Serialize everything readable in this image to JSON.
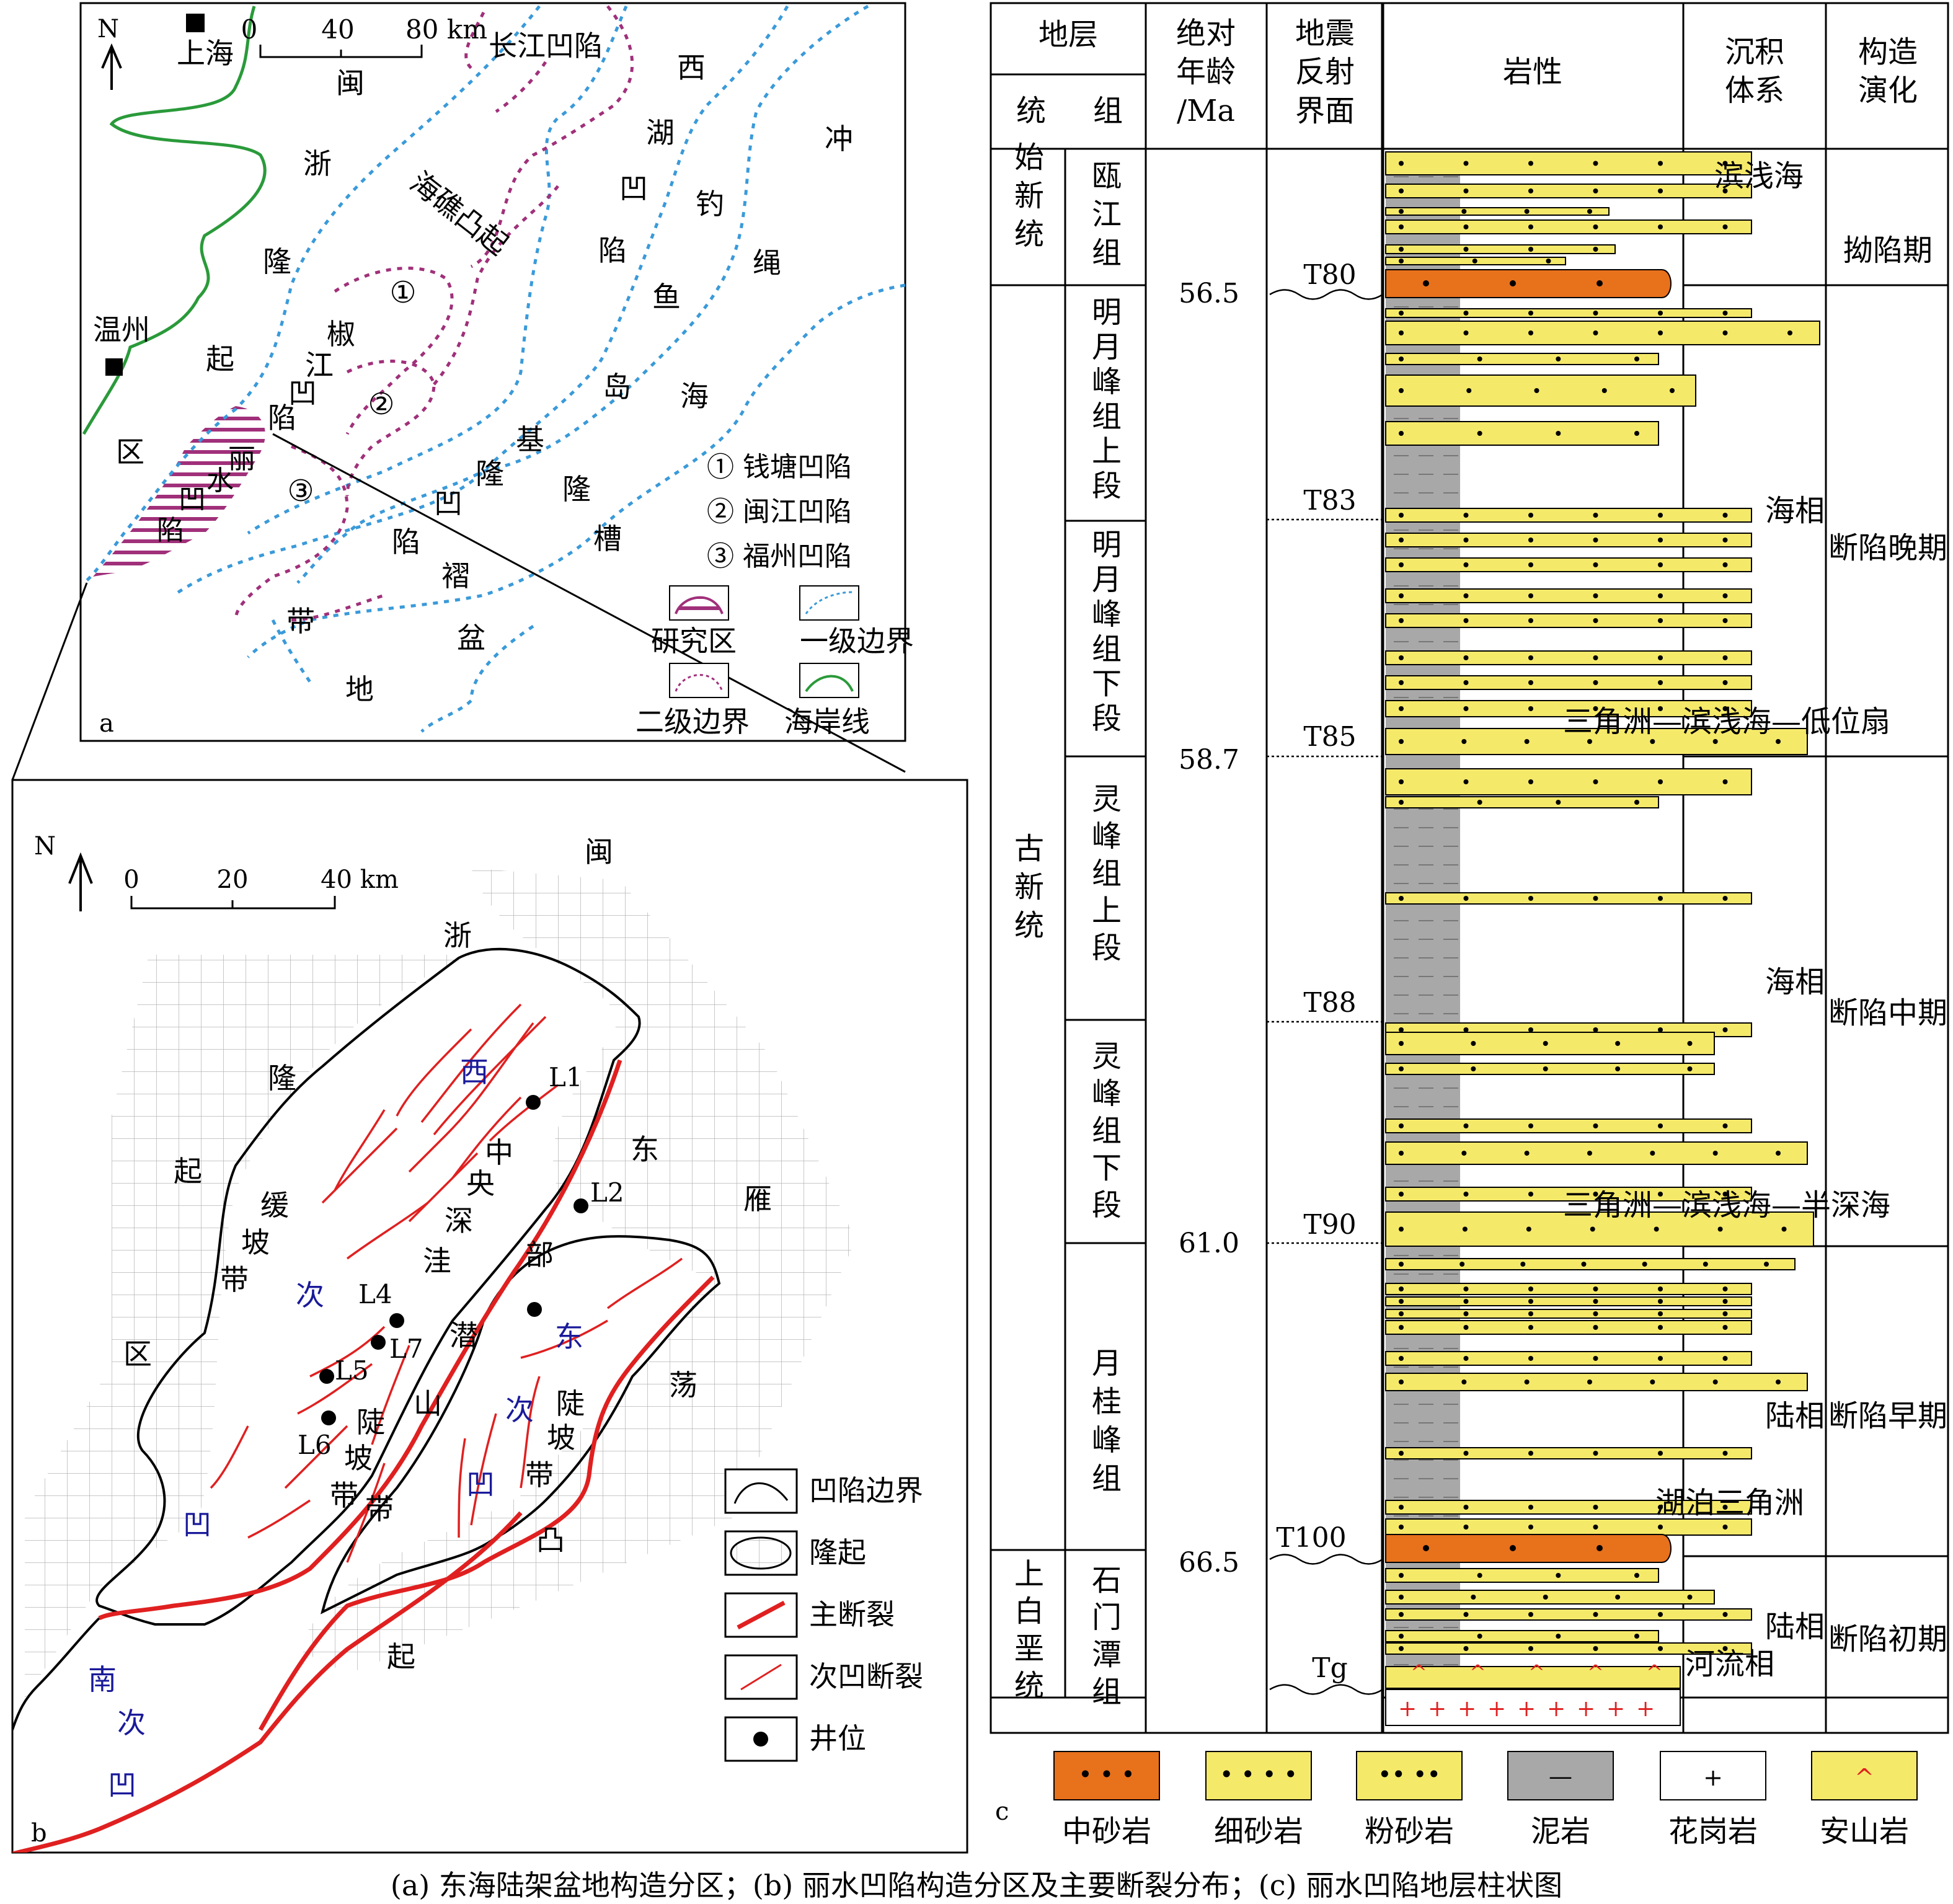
{
  "colors": {
    "study_area": "#a0307a",
    "level1_boundary": "#3a9ad9",
    "level2_boundary": "#a0307a",
    "coastline": "#2a9a3a",
    "main_fault": "#e02020",
    "medium_sandstone": "#e8711c",
    "fine_sandstone": "#f5e96a",
    "mudstone": "#a8a8a8"
  },
  "panel_a": {
    "letter": "a",
    "north": "N",
    "scale": [
      "0",
      "40",
      "80 km"
    ],
    "cities": [
      "上海",
      "温州"
    ],
    "region_chars": {
      "min": "闽",
      "zhe": "浙",
      "long1": "隆",
      "qi": "起",
      "qu": "区",
      "xi": "西",
      "hu": "湖",
      "ao1": "凹",
      "xian1": "陷",
      "chong": "冲",
      "sheng": "绳",
      "diao": "钓",
      "yu": "鱼",
      "dao": "岛",
      "hai": "海",
      "ji": "基",
      "long2": "隆",
      "long3": "隆",
      "cao": "槽",
      "jiao": "椒",
      "jiang": "江",
      "ao2": "凹",
      "xian2": "陷",
      "ao3": "凹",
      "xian3": "陷",
      "zhe2": "褶",
      "dai": "带",
      "pen": "盆",
      "di": "地"
    },
    "changjiang": "长江凹陷",
    "haijiao": "海礁凸起",
    "lishui": [
      "丽",
      "水",
      "凹",
      "陷"
    ],
    "circles": [
      "①",
      "②",
      "③"
    ],
    "sag_legend": [
      "① 钱塘凹陷",
      "② 闽江凹陷",
      "③ 福州凹陷"
    ],
    "legend": [
      "研究区",
      "一级边界",
      "二级边界",
      "海岸线"
    ]
  },
  "panel_b": {
    "letter": "b",
    "north": "N",
    "scale": [
      "0",
      "20",
      "40 km"
    ],
    "region_chars": [
      "闽",
      "浙",
      "隆",
      "起",
      "区",
      "东",
      "雁",
      "荡",
      "凸",
      "起"
    ],
    "slope_west": [
      "缓",
      "坡",
      "带"
    ],
    "central": [
      "中",
      "央",
      "深",
      "洼"
    ],
    "west_sub": [
      "西",
      "次",
      "凹"
    ],
    "east_sub": [
      "东",
      "次",
      "凹"
    ],
    "south_sub": [
      "南",
      "次",
      "凹"
    ],
    "buried_hill": [
      "部",
      "潜",
      "山",
      "带"
    ],
    "steep_west": [
      "陡",
      "坡",
      "带"
    ],
    "steep_east": [
      "陡",
      "坡",
      "带"
    ],
    "wells": [
      "L1",
      "L2",
      "L4",
      "L7",
      "L5",
      "L6"
    ],
    "legend": [
      "凹陷边界",
      "隆起",
      "主断裂",
      "次凹断裂",
      "井位"
    ]
  },
  "panel_c": {
    "letter": "c",
    "headers": {
      "strata": "地层",
      "series": "统",
      "formation": "组",
      "age": [
        "绝对",
        "年龄",
        "/Ma"
      ],
      "seismic": [
        "地震",
        "反射",
        "界面"
      ],
      "lith": "岩性",
      "sed": [
        "沉积",
        "体系"
      ],
      "tect": [
        "构造",
        "演化"
      ]
    },
    "series_col": [
      "始新统",
      "古新统",
      "上白垩统"
    ],
    "formations": [
      "瓯江组",
      "明月峰组上段",
      "明月峰组下段",
      "灵峰组上段",
      "灵峰组下段",
      "月桂峰组",
      "石门潭组"
    ],
    "ages": [
      "56.5",
      "58.7",
      "61.0",
      "66.5"
    ],
    "horizons": [
      "T80",
      "T83",
      "T85",
      "T88",
      "T90",
      "T100",
      "Tg"
    ],
    "sedimentary": {
      "s1": "滨浅海",
      "s2": "三角洲—滨浅海—低位扇",
      "s2b": "海相",
      "s3": "三角洲—滨浅海—半深海",
      "s3b": "海相",
      "s4": "湖泊三角洲",
      "s4b": "陆相",
      "s5": "河流相",
      "s5b": "陆相"
    },
    "tectonic": [
      "拗陷期",
      "断陷晚期",
      "断陷中期",
      "断陷早期",
      "断陷初期"
    ],
    "legend": [
      "中砂岩",
      "细砂岩",
      "粉砂岩",
      "泥岩",
      "花岗岩",
      "安山岩"
    ],
    "legend_symbols": [
      "• • •",
      "• • • •",
      "•• ••",
      "—",
      "+",
      "^"
    ]
  },
  "caption": "(a) 东海陆架盆地构造分区；(b) 丽水凹陷构造分区及主要断裂分布；(c) 丽水凹陷地层柱状图"
}
